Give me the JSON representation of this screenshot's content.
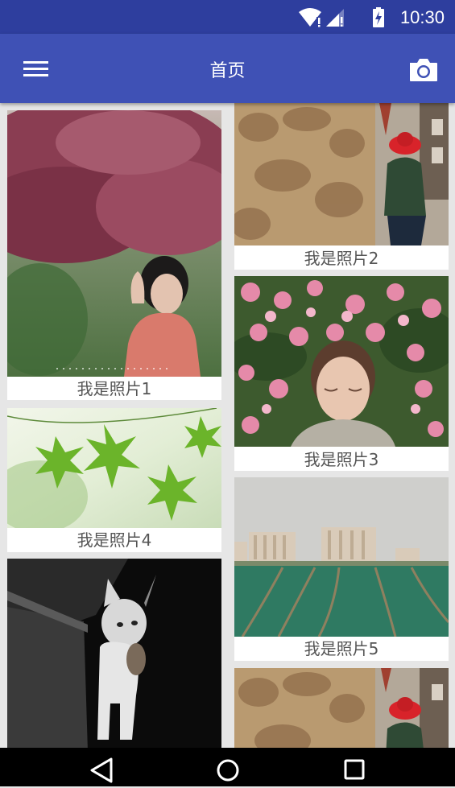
{
  "status_bar": {
    "time": "10:30",
    "icons": [
      "wifi-icon",
      "signal-icon",
      "battery-charging-icon"
    ]
  },
  "app_bar": {
    "title": "首页",
    "menu_icon": "menu-icon",
    "camera_icon": "camera-icon"
  },
  "colors": {
    "primary": "#3f51b5",
    "primary_dark": "#2e3e9e",
    "background": "#e6e6e6",
    "caption_text": "#555555"
  },
  "photos": [
    {
      "caption": "我是照片1",
      "subject": "woman under red maple tree"
    },
    {
      "caption": "我是照片2",
      "subject": "woman in red hat by old wall"
    },
    {
      "caption": "我是照片3",
      "subject": "woman with pink flowers"
    },
    {
      "caption": "我是照片4",
      "subject": "green maple leaves"
    },
    {
      "caption": "我是照片5",
      "subject": "green field with city buildings"
    },
    {
      "caption": "",
      "subject": "black and white cat"
    },
    {
      "caption": "",
      "subject": "woman in red hat by old wall"
    }
  ],
  "nav_bar": {
    "buttons": [
      "back-icon",
      "home-icon",
      "recents-icon"
    ]
  }
}
